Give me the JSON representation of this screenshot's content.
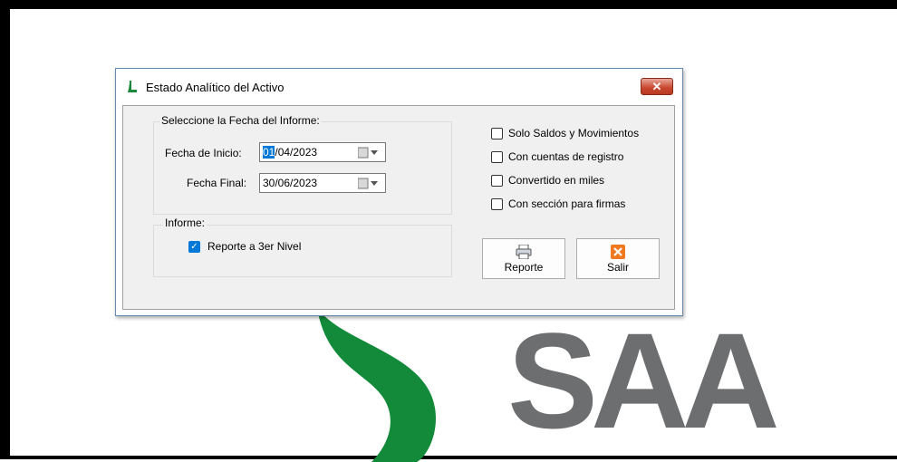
{
  "window": {
    "title": "Estado Analítico del Activo",
    "close_symbol": "✕"
  },
  "fecha_group": {
    "legend": "Seleccione la Fecha del Informe:",
    "inicio_label": "Fecha de Inicio:",
    "inicio_value_selected": "01",
    "inicio_value_rest": "/04/2023",
    "final_label": "Fecha Final:",
    "final_value": "30/06/2023"
  },
  "informe_group": {
    "legend": "Informe:",
    "reporte_nivel_label": "Reporte a 3er Nivel",
    "reporte_nivel_checked": true
  },
  "options": [
    {
      "label": "Solo Saldos y Movimientos",
      "checked": false
    },
    {
      "label": "Con cuentas de registro",
      "checked": false
    },
    {
      "label": "Convertido en miles",
      "checked": false
    },
    {
      "label": "Con sección para firmas",
      "checked": false
    }
  ],
  "buttons": {
    "reporte_label": "Reporte",
    "salir_label": "Salir"
  },
  "background": {
    "logo_text": "SAA"
  },
  "colors": {
    "accent": "#0078d7",
    "logo_green": "#138a3a",
    "logo_gray": "#6d6e70",
    "close_red": "#c8452d"
  }
}
